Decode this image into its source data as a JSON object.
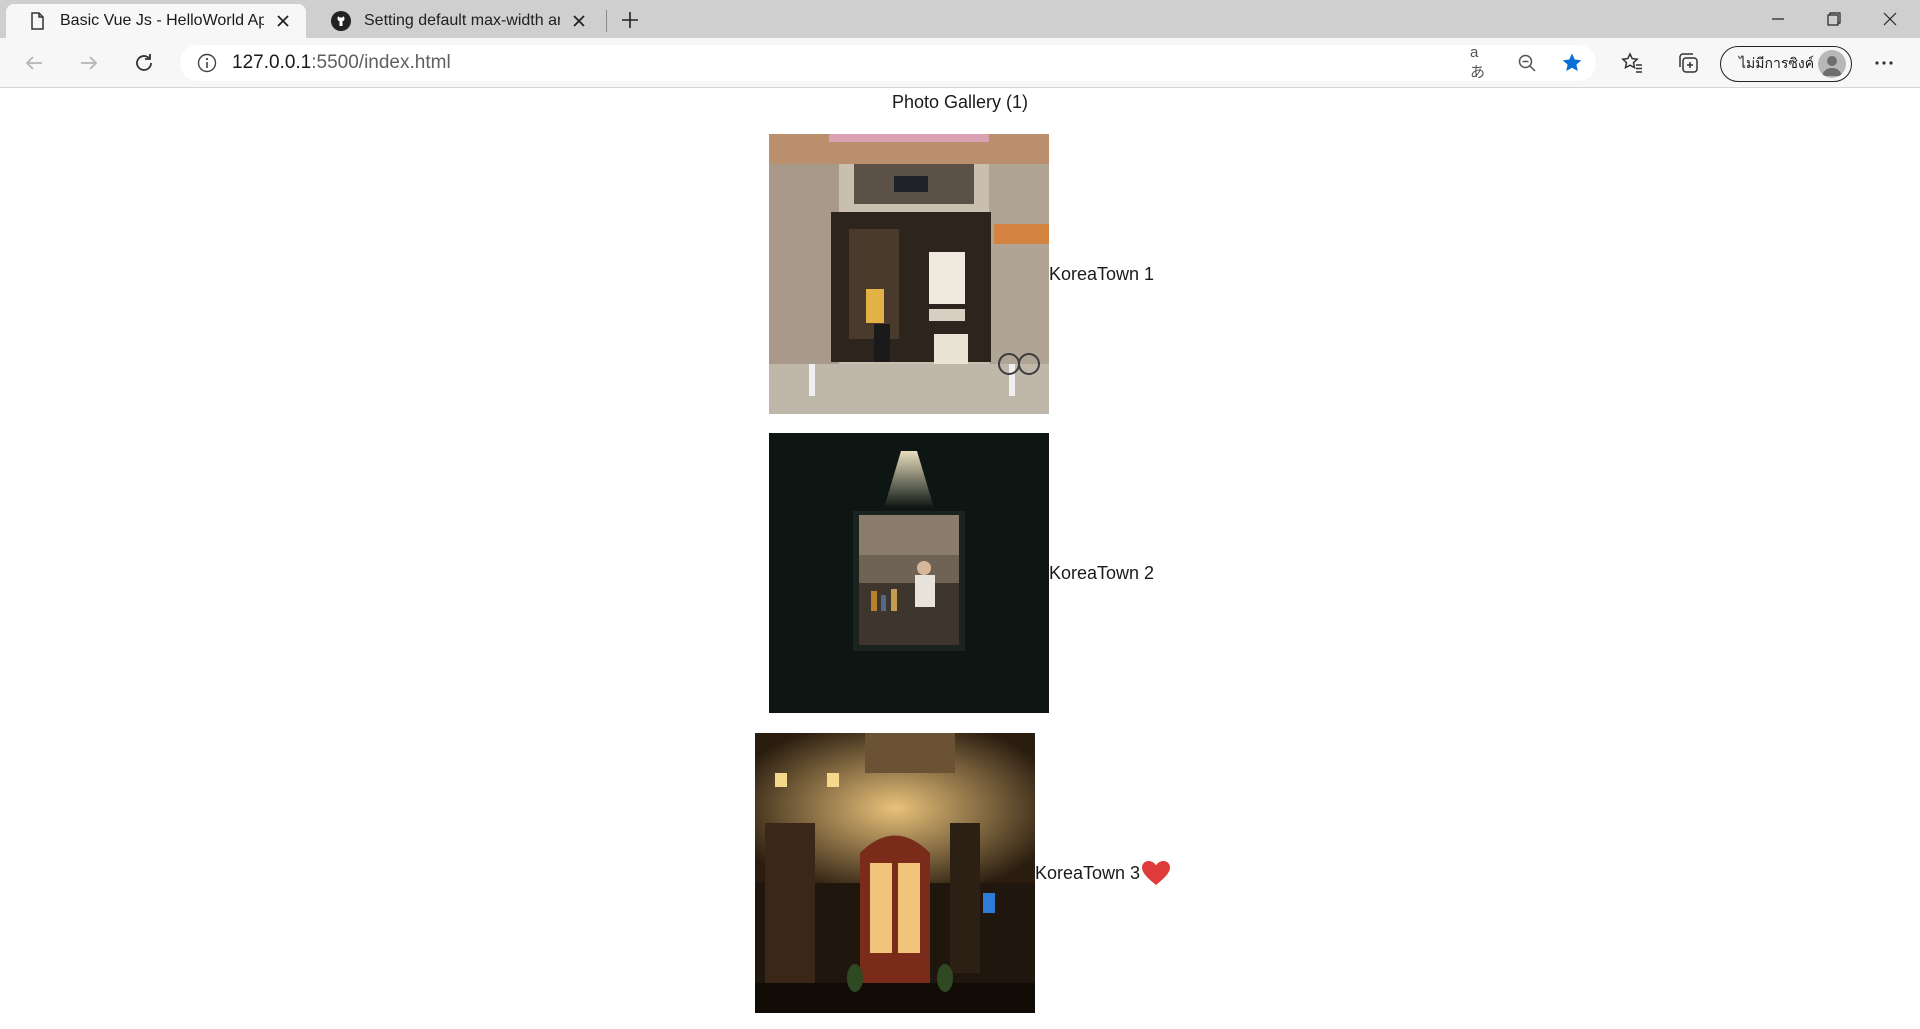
{
  "browser": {
    "tabs": [
      {
        "title": "Basic Vue Js - HelloWorld App",
        "icon": "page-icon",
        "active": true
      },
      {
        "title": "Setting default max-width and height",
        "icon": "github-icon",
        "active": false
      }
    ],
    "address": {
      "host": "127.0.0.1",
      "path": ":5500/index.html"
    },
    "read_aloud_label": "aあ",
    "profile_label": "ไม่มีการซิงค์"
  },
  "page": {
    "title": "Photo Gallery (1)",
    "photos": [
      {
        "caption": "KoreaTown 1",
        "liked": false,
        "scene": "storefront-daytime"
      },
      {
        "caption": "KoreaTown 2",
        "liked": false,
        "scene": "lit-window-at-night"
      },
      {
        "caption": "KoreaTown 3",
        "liked": true,
        "scene": "old-town-doorway-at-night"
      }
    ]
  },
  "colors": {
    "accent_star": "#0a6fd6",
    "heart": "#e03b3b"
  }
}
